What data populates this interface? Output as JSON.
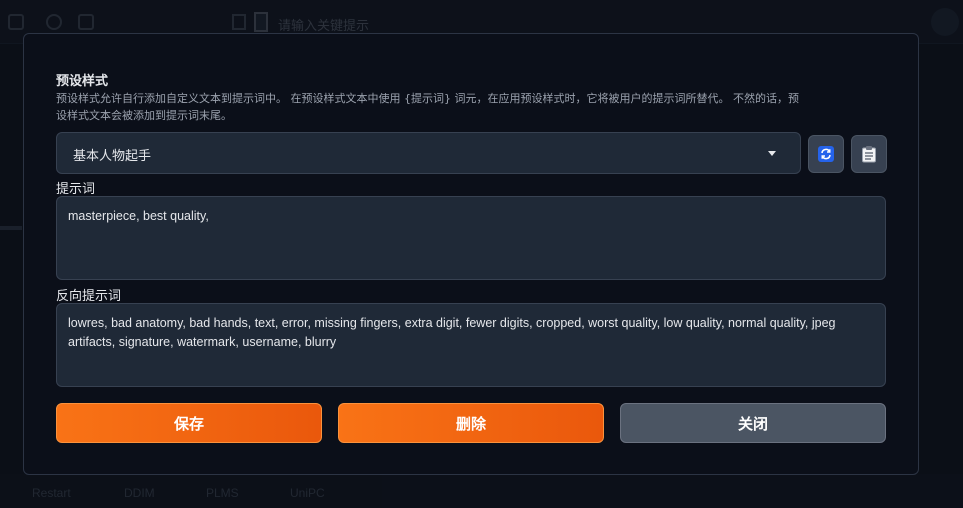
{
  "background": {
    "hint_text": "请输入关键提示",
    "sampler_tabs": [
      "Restart",
      "DDIM",
      "PLMS",
      "UniPC"
    ]
  },
  "modal": {
    "title": "预设样式",
    "description": "预设样式允许自行添加自定义文本到提示词中。 在预设样式文本中使用 {提示词} 词元，在应用预设样式时，它将被用户的提示词所替代。 不然的话，预设样式文本会被添加到提示词末尾。",
    "style_select": {
      "selected": "基本人物起手"
    },
    "prompt_label": "提示词",
    "prompt_value": "masterpiece, best quality,",
    "negative_label": "反向提示词",
    "negative_value": "lowres, bad anatomy, bad hands, text, error, missing fingers, extra digit, fewer digits, cropped, worst quality, low quality, normal quality, jpeg artifacts, signature, watermark, username, blurry",
    "buttons": {
      "save": "保存",
      "delete": "删除",
      "close": "关闭"
    },
    "icons": {
      "refresh": "refresh-icon",
      "paste": "clipboard-icon"
    }
  },
  "colors": {
    "accent_orange": "#f97316",
    "panel_bg": "#1f2937",
    "modal_bg": "#0b0f19",
    "refresh_icon_blue": "#3b82f6"
  }
}
